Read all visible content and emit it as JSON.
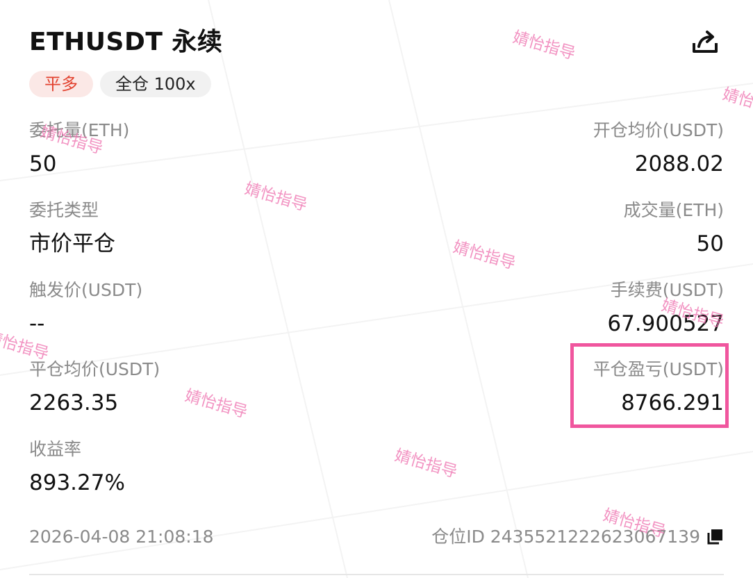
{
  "header": {
    "title": "ETHUSDT 永续"
  },
  "tags": {
    "side": "平多",
    "mode": "全仓 100x"
  },
  "fields": {
    "order_qty": {
      "label": "委托量(ETH)",
      "value": "50"
    },
    "open_avg_price": {
      "label": "开仓均价(USDT)",
      "value": "2088.02"
    },
    "order_type": {
      "label": "委托类型",
      "value": "市价平仓"
    },
    "filled_qty": {
      "label": "成交量(ETH)",
      "value": "50"
    },
    "trigger_price": {
      "label": "触发价(USDT)",
      "value": "--"
    },
    "fee": {
      "label": "手续费(USDT)",
      "value": "67.900527"
    },
    "close_avg_price": {
      "label": "平仓均价(USDT)",
      "value": "2263.35"
    },
    "close_pnl": {
      "label": "平仓盈亏(USDT)",
      "value": "8766.291"
    },
    "roi": {
      "label": "收益率",
      "value": "893.27%"
    }
  },
  "footer": {
    "timestamp": "2026-04-08 21:08:18",
    "position_id": "仓位ID 2435521222623067139"
  },
  "watermark": {
    "text": "婧怡指导",
    "color": "#ee6fae"
  },
  "colors": {
    "side_tag_text": "#e2412e",
    "side_tag_bg": "#fbe8e6",
    "highlight_border": "#f0569e"
  },
  "icons": {
    "share": "share-icon",
    "copy": "copy-icon"
  }
}
